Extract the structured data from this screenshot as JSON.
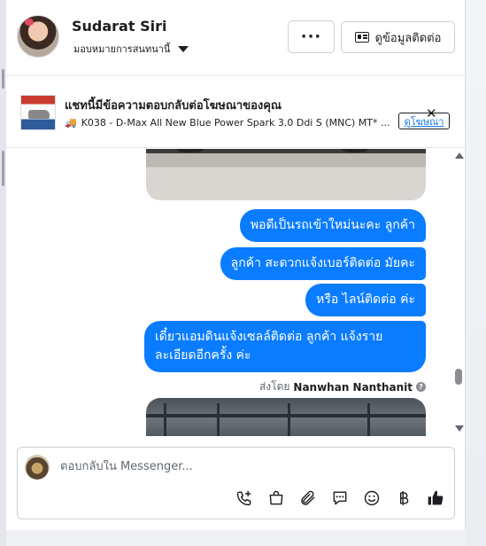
{
  "header": {
    "contact_name": "Sudarat Siri",
    "assign_label": "มอบหมายการสนทนานี้",
    "more_label": "···",
    "contact_info_label": "ดูข้อมูลติดต่อ"
  },
  "ad_banner": {
    "title": "แชทนี้มีข้อความตอบกลับต่อโฆษณาของคุณ",
    "subtitle": "K038 - D-Max All New Blue Power Spark 3.0 Ddi S (MNC) MT* ...",
    "view_ad_label": "ดูโฆษณา",
    "close_label": "✕"
  },
  "thread": {
    "messages": [
      "พอดีเป็นรถเข้าใหม่นะคะ  ลูกค้า",
      "ลูกค้า สะดวกแจ้งเบอร์ติดต่อ มัยคะ",
      "หรือ ไลน์ติดต่อ ค่ะ",
      "เดี๋ยวแอมดินแจ้งเซลล์ติดต่อ ลูกค้า   แจ้งรายละเอียดอีกครั้ง  ค่ะ"
    ],
    "sent_by_prefix": "ส่งโดย",
    "sent_by_name": "Nanwhan Nanthanit",
    "help_glyph": "?"
  },
  "composer": {
    "placeholder": "ตอบกลับใน Messenger...",
    "tools": [
      "call-add-icon",
      "bag-icon",
      "paperclip-icon",
      "saved-replies-icon",
      "emoji-icon",
      "baht-icon",
      "like-icon"
    ]
  },
  "colors": {
    "accent": "#0a7cff",
    "link": "#1877f2"
  }
}
